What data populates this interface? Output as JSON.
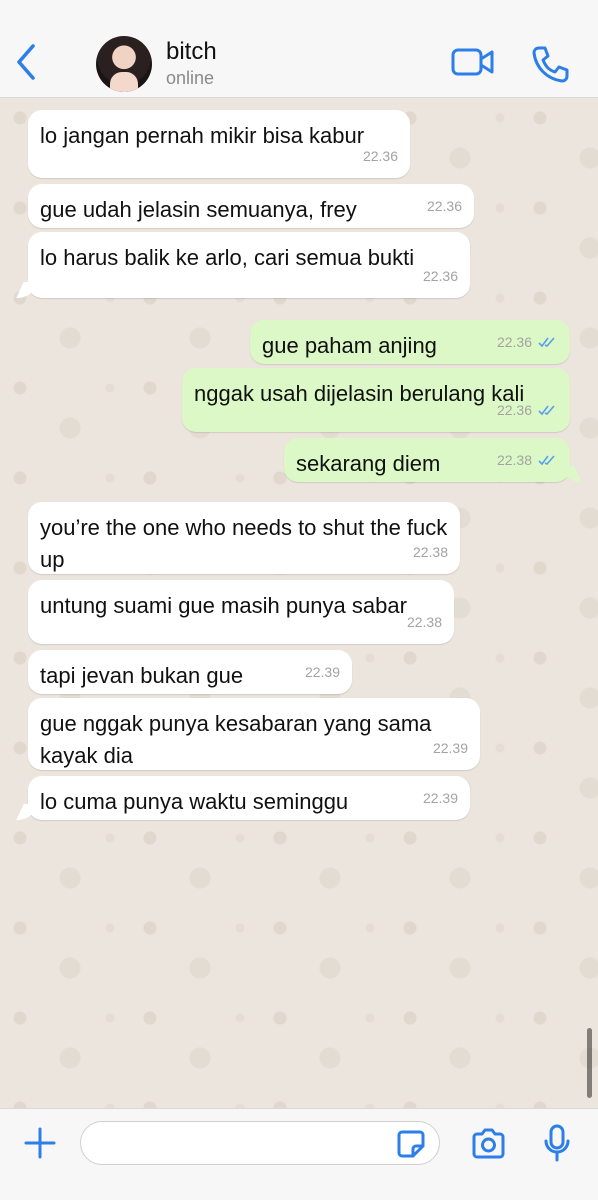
{
  "header": {
    "contact_name": "bitch",
    "status": "online"
  },
  "messages": [
    {
      "dir": "in",
      "text": "lo jangan pernah mikir bisa kabur",
      "time": "22.36"
    },
    {
      "dir": "in",
      "text": "gue udah jelasin semuanya, frey",
      "time": "22.36"
    },
    {
      "dir": "in",
      "text": "lo harus balik ke arlo, cari semua bukti",
      "time": "22.36"
    },
    {
      "dir": "out",
      "text": "gue paham anjing",
      "time": "22.36",
      "read": true
    },
    {
      "dir": "out",
      "text": "nggak usah dijelasin berulang kali",
      "time": "22.36",
      "read": true
    },
    {
      "dir": "out",
      "text": "sekarang diem",
      "time": "22.38",
      "read": true
    },
    {
      "dir": "in",
      "text": "you’re the one who needs to shut the fuck up",
      "time": "22.38"
    },
    {
      "dir": "in",
      "text": "untung suami gue masih punya sabar",
      "time": "22.38"
    },
    {
      "dir": "in",
      "text": "tapi jevan bukan gue",
      "time": "22.39"
    },
    {
      "dir": "in",
      "text": "gue nggak punya kesabaran yang sama kayak dia",
      "time": "22.39"
    },
    {
      "dir": "in",
      "text": "lo cuma punya waktu seminggu",
      "time": "22.39"
    }
  ],
  "composer": {
    "value": "",
    "placeholder": ""
  },
  "colors": {
    "accent": "#2c7ee8",
    "outgoing_bubble": "#dcf8c6",
    "incoming_bubble": "#ffffff",
    "chat_background": "#ece5dd"
  },
  "icons": [
    "back-chevron-icon",
    "video-call-icon",
    "phone-icon",
    "plus-icon",
    "sticker-icon",
    "camera-icon",
    "microphone-icon",
    "double-check-icon"
  ]
}
